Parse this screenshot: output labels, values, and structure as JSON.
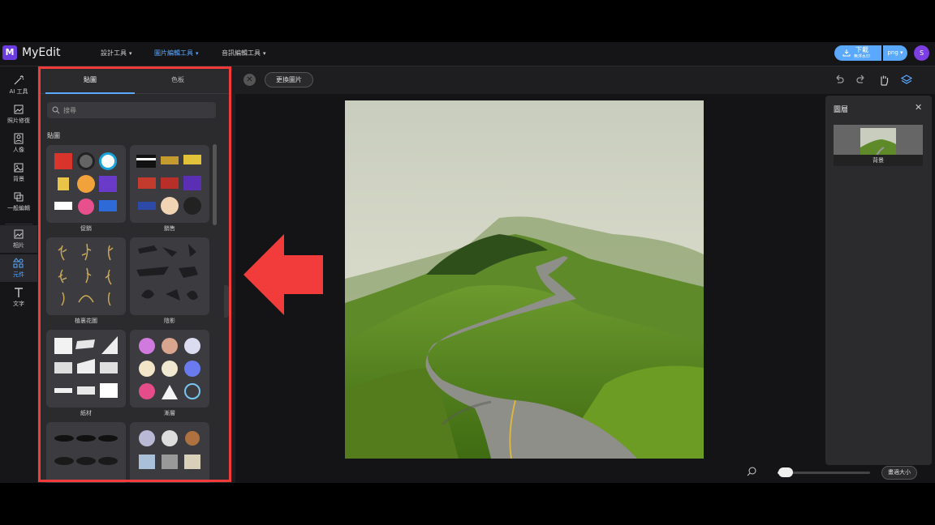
{
  "app": {
    "logo_letter": "M",
    "name": "MyEdit"
  },
  "nav": [
    {
      "label": "設計工具"
    },
    {
      "label": "圖片編輯工具"
    },
    {
      "label": "音訊編輯工具"
    }
  ],
  "download": {
    "label": "下載",
    "sub": "無浮水印",
    "format": "png",
    "avatar": "S"
  },
  "rail": [
    {
      "label": "AI 工具",
      "icon": "magic-wand-icon"
    },
    {
      "label": "照片修復",
      "icon": "photo-repair-icon"
    },
    {
      "label": "人像",
      "icon": "portrait-icon"
    },
    {
      "label": "背景",
      "icon": "background-icon"
    },
    {
      "label": "一般編輯",
      "icon": "crop-icon"
    },
    {
      "label": "相片",
      "icon": "photo-icon"
    },
    {
      "label": "元件",
      "icon": "elements-icon"
    },
    {
      "label": "文字",
      "icon": "text-icon"
    }
  ],
  "panel": {
    "tabs": [
      "貼圖",
      "色板"
    ],
    "search_placeholder": "搜尋",
    "section_title": "貼圖",
    "cards": [
      {
        "label": "促銷"
      },
      {
        "label": "銷售"
      },
      {
        "label": "植裏花圖"
      },
      {
        "label": "陰影"
      },
      {
        "label": "紙材"
      },
      {
        "label": "漸層"
      },
      {
        "label": ""
      },
      {
        "label": ""
      }
    ]
  },
  "canvas": {
    "replace_label": "更換圖片"
  },
  "layers": {
    "title": "圖層",
    "item_label": "背景"
  },
  "zoom": {
    "fit_label": "畫適大小",
    "level": 0.08
  },
  "colors": {
    "accent": "#5aa9ff",
    "highlight": "#f23c3c",
    "brand": "#6d3ce0"
  }
}
